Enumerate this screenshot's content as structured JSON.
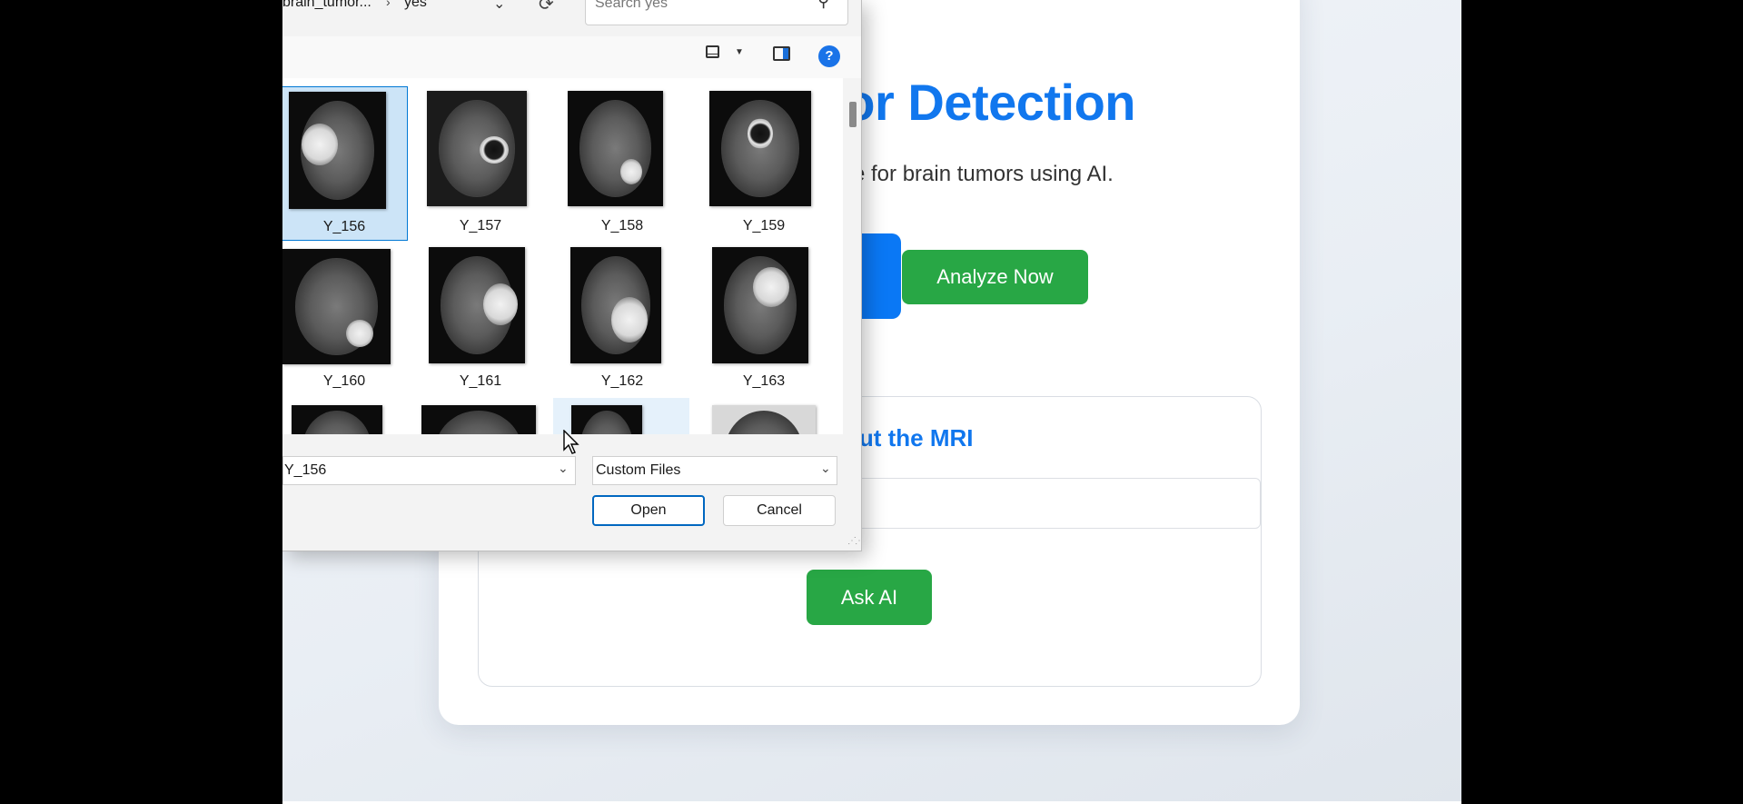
{
  "app": {
    "title_partial": "or Detection",
    "subtitle_partial": "yze for brain tumors using AI.",
    "analyze_button": "Analyze Now",
    "qa_heading_partial": "out the MRI",
    "ask_button": "Ask AI",
    "colors": {
      "accent_blue": "#1177ee",
      "button_green": "#28a745"
    }
  },
  "dialog": {
    "breadcrumb_folder": "brain_tumor...",
    "breadcrumb_separator": "›",
    "breadcrumb_current": "yes",
    "search_placeholder": "Search yes",
    "toolbar": {
      "view_icon": "view-icon",
      "preview_pane_icon": "preview-pane-icon",
      "help_glyph": "?"
    },
    "files": [
      {
        "name": "Y_156",
        "state": "selected"
      },
      {
        "name": "Y_157"
      },
      {
        "name": "Y_158"
      },
      {
        "name": "Y_159"
      },
      {
        "name": "Y_160"
      },
      {
        "name": "Y_161"
      },
      {
        "name": "Y_162"
      },
      {
        "name": "Y_163"
      },
      {
        "name": ""
      },
      {
        "name": ""
      },
      {
        "name": "",
        "state": "hover"
      },
      {
        "name": ""
      }
    ],
    "filename_value": "Y_156",
    "filter_value": "Custom Files",
    "open_button": "Open",
    "cancel_button": "Cancel"
  }
}
